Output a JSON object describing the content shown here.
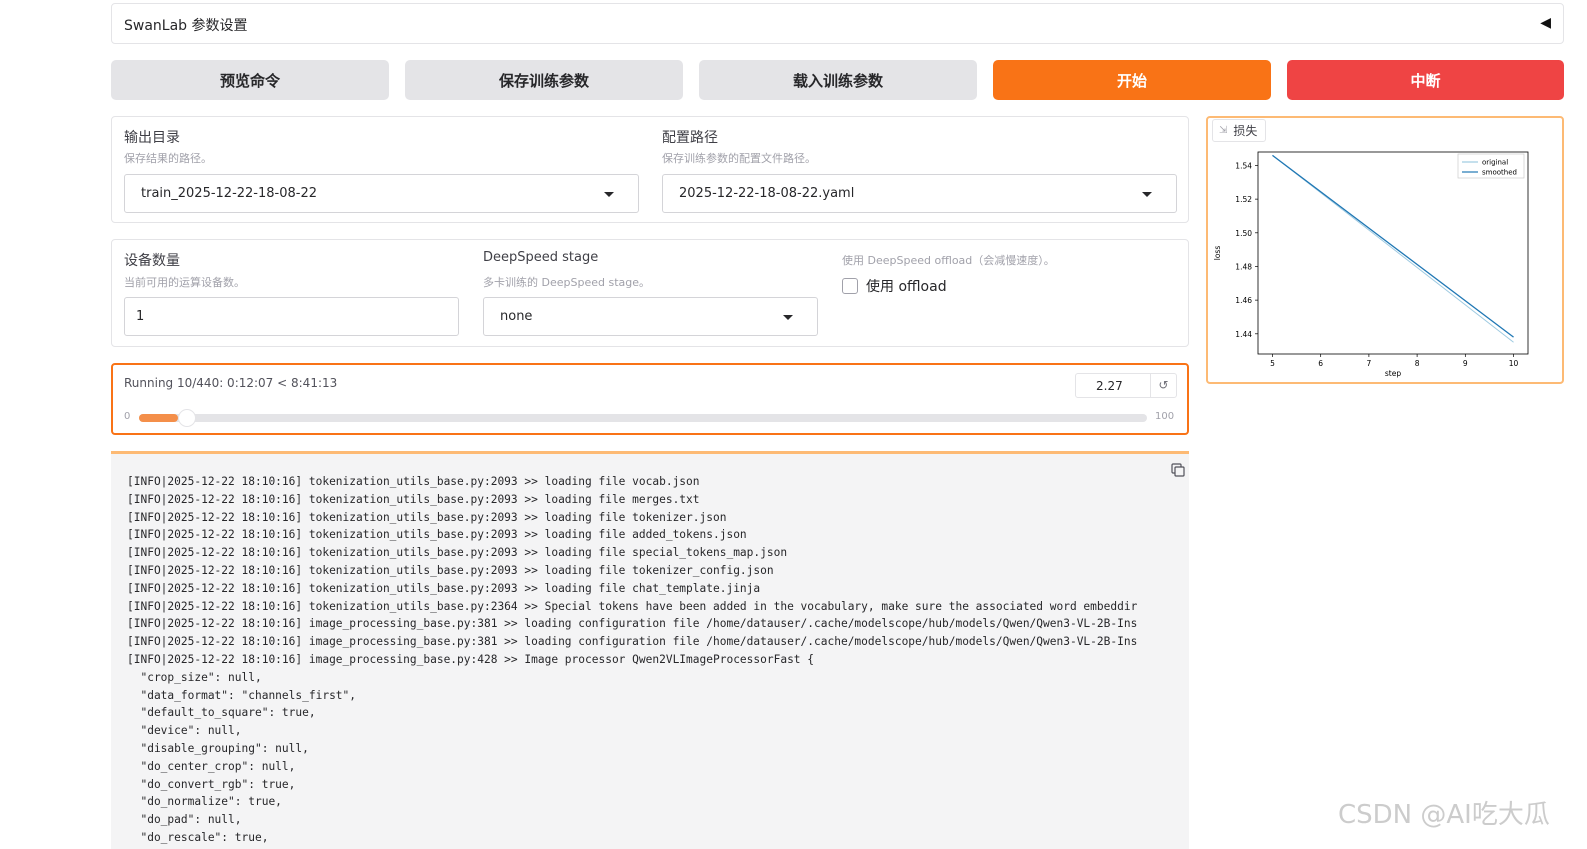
{
  "accordion": {
    "title": "SwanLab 参数设置",
    "caret": "◀"
  },
  "buttons": {
    "preview": "预览命令",
    "save": "保存训练参数",
    "load": "载入训练参数",
    "start": "开始",
    "abort": "中断"
  },
  "output_dir": {
    "label": "输出目录",
    "info": "保存结果的路径。",
    "value": "train_2025-12-22-18-08-22"
  },
  "config_path": {
    "label": "配置路径",
    "info": "保存训练参数的配置文件路径。",
    "value": "2025-12-22-18-08-22.yaml"
  },
  "device_count": {
    "label": "设备数量",
    "info": "当前可用的运算设备数。",
    "value": "1"
  },
  "ds_stage": {
    "label": "DeepSpeed stage",
    "info": "多卡训练的 DeepSpeed stage。",
    "value": "none"
  },
  "ds_offload": {
    "info": "使用 DeepSpeed offload（会减慢速度）。",
    "checkbox_label": "使用 offload",
    "checked": false
  },
  "progress": {
    "status": "Running 10/440: 0:12:07 < 8:41:13",
    "number": "2.27",
    "reset_icon": "↺",
    "min": "0",
    "max": "100",
    "value": 2.27
  },
  "plot": {
    "tag": "损失",
    "tag_icon": "chart-icon"
  },
  "chart_data": {
    "type": "line",
    "title": "",
    "xlabel": "step",
    "ylabel": "loss",
    "xlim": [
      4.7,
      10.3
    ],
    "ylim": [
      1.428,
      1.548
    ],
    "xticks": [
      "5",
      "6",
      "7",
      "8",
      "9",
      "10"
    ],
    "yticks": [
      "1.44",
      "1.46",
      "1.48",
      "1.50",
      "1.52",
      "1.54"
    ],
    "series": [
      {
        "name": "original",
        "color": "#9ecae1",
        "x": [
          5,
          10
        ],
        "y": [
          1.546,
          1.435
        ]
      },
      {
        "name": "smoothed",
        "color": "#1f77b4",
        "x": [
          5,
          10
        ],
        "y": [
          1.546,
          1.438
        ]
      }
    ],
    "legend": "top-right"
  },
  "log": {
    "lines": [
      "[INFO|2025-12-22 18:10:16] tokenization_utils_base.py:2093 >> loading file vocab.json",
      "[INFO|2025-12-22 18:10:16] tokenization_utils_base.py:2093 >> loading file merges.txt",
      "[INFO|2025-12-22 18:10:16] tokenization_utils_base.py:2093 >> loading file tokenizer.json",
      "[INFO|2025-12-22 18:10:16] tokenization_utils_base.py:2093 >> loading file added_tokens.json",
      "[INFO|2025-12-22 18:10:16] tokenization_utils_base.py:2093 >> loading file special_tokens_map.json",
      "[INFO|2025-12-22 18:10:16] tokenization_utils_base.py:2093 >> loading file tokenizer_config.json",
      "[INFO|2025-12-22 18:10:16] tokenization_utils_base.py:2093 >> loading file chat_template.jinja",
      "[INFO|2025-12-22 18:10:16] tokenization_utils_base.py:2364 >> Special tokens have been added in the vocabulary, make sure the associated word embeddir",
      "[INFO|2025-12-22 18:10:16] image_processing_base.py:381 >> loading configuration file /home/datauser/.cache/modelscope/hub/models/Qwen/Qwen3-VL-2B-Ins",
      "[INFO|2025-12-22 18:10:16] image_processing_base.py:381 >> loading configuration file /home/datauser/.cache/modelscope/hub/models/Qwen/Qwen3-VL-2B-Ins",
      "[INFO|2025-12-22 18:10:16] image_processing_base.py:428 >> Image processor Qwen2VLImageProcessorFast {",
      "  \"crop_size\": null,",
      "  \"data_format\": \"channels_first\",",
      "  \"default_to_square\": true,",
      "  \"device\": null,",
      "  \"disable_grouping\": null,",
      "  \"do_center_crop\": null,",
      "  \"do_convert_rgb\": true,",
      "  \"do_normalize\": true,",
      "  \"do_pad\": null,",
      "  \"do_rescale\": true,"
    ]
  },
  "watermark": "CSDN @AI吃大瓜"
}
